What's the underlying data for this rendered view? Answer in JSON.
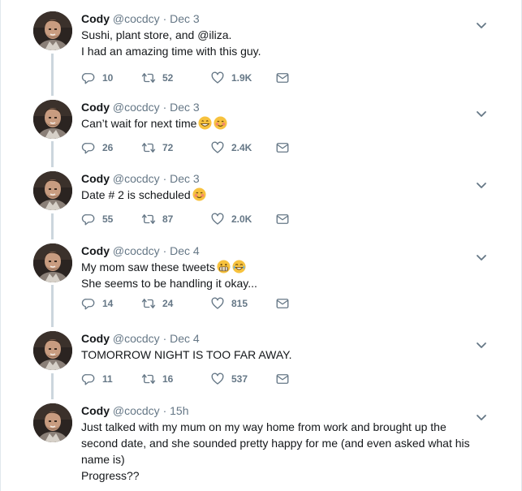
{
  "tweets": [
    {
      "name": "Cody",
      "handle": "@cocdcy",
      "separator": "·",
      "date": "Dec 3",
      "lines": [
        "Sushi, plant store, and @iliza.",
        "I had an amazing time with this guy."
      ],
      "emojis": [],
      "replies": "10",
      "retweets": "52",
      "likes": "1.9K"
    },
    {
      "name": "Cody",
      "handle": "@cocdcy",
      "separator": "·",
      "date": "Dec 3",
      "lines": [
        "Can’t wait for next time"
      ],
      "emojis": [
        "grinning-face-emoji",
        "smiling-face-blush-emoji"
      ],
      "replies": "26",
      "retweets": "72",
      "likes": "2.4K"
    },
    {
      "name": "Cody",
      "handle": "@cocdcy",
      "separator": "·",
      "date": "Dec 3",
      "lines": [
        "Date # 2 is scheduled"
      ],
      "emojis": [
        "smiling-face-blush-emoji"
      ],
      "replies": "55",
      "retweets": "87",
      "likes": "2.0K"
    },
    {
      "name": "Cody",
      "handle": "@cocdcy",
      "separator": "·",
      "date": "Dec 4",
      "lines": [
        "My mom saw these tweets",
        "She seems to be handling it okay..."
      ],
      "emojis": [
        "grimacing-face-emoji",
        "tears-of-joy-emoji"
      ],
      "replies": "14",
      "retweets": "24",
      "likes": "815"
    },
    {
      "name": "Cody",
      "handle": "@cocdcy",
      "separator": "·",
      "date": "Dec 4",
      "lines": [
        "TOMORROW NIGHT IS TOO FAR AWAY."
      ],
      "emojis": [],
      "replies": "11",
      "retweets": "16",
      "likes": "537"
    },
    {
      "name": "Cody",
      "handle": "@cocdcy",
      "separator": "·",
      "date": "15h",
      "lines": [
        "Just talked with my mum on my way home from work and brought up the",
        "second date, and she sounded pretty happy for me (and even asked what his",
        "name is)",
        "Progress??"
      ],
      "emojis": [],
      "replies": null,
      "retweets": null,
      "likes": null
    }
  ],
  "icons": {
    "reply": "reply-icon",
    "retweet": "retweet-icon",
    "like": "heart-icon",
    "dm": "envelope-icon",
    "caret": "chevron-down-icon"
  },
  "colors": {
    "text": "#14171a",
    "muted": "#657786",
    "thread_line": "#ccd6dd"
  }
}
